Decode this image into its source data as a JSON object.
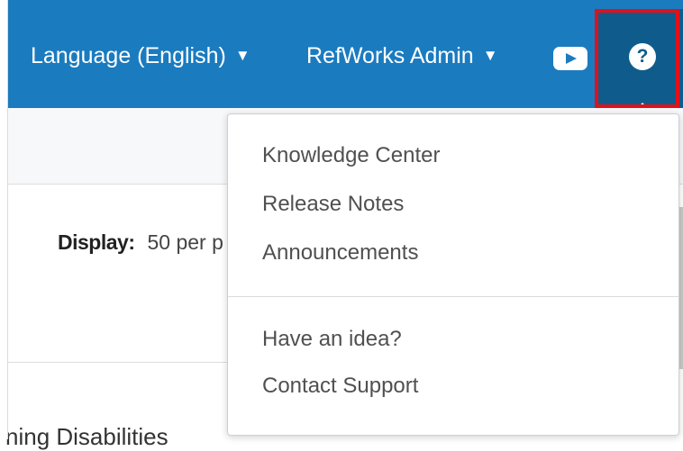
{
  "header": {
    "language_label": "Language (English)",
    "caret": "▼",
    "admin_label": "RefWorks Admin",
    "help_glyph": "?"
  },
  "content": {
    "display_label": "Display:",
    "display_value": "50 per p",
    "cut_heading": "ning Disabilities"
  },
  "help_menu": {
    "items": [
      "Knowledge Center",
      "Release Notes",
      "Announcements",
      "Have an idea?",
      "Contact Support"
    ]
  },
  "colors": {
    "header_bg": "#1b7bbf",
    "help_active_bg": "#0f5c8c",
    "highlight_border": "#e3101a"
  },
  "icons": [
    "youtube-icon",
    "help-icon",
    "caret-down-icon"
  ]
}
